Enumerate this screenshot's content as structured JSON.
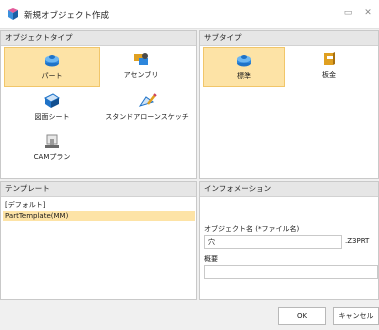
{
  "window": {
    "title": "新規オブジェクト作成"
  },
  "object_type": {
    "header": "オブジェクトタイプ",
    "items": [
      {
        "label": "パート",
        "icon": "part-icon",
        "selected": true
      },
      {
        "label": "アセンブリ",
        "icon": "assembly-icon",
        "selected": false
      },
      {
        "label": "図面シート",
        "icon": "drawing-sheet-icon",
        "selected": false
      },
      {
        "label": "スタンドアローンスケッチ",
        "icon": "standalone-sketch-icon",
        "selected": false
      },
      {
        "label": "CAMプラン",
        "icon": "cam-plan-icon",
        "selected": false
      }
    ]
  },
  "sub_type": {
    "header": "サブタイプ",
    "items": [
      {
        "label": "標準",
        "icon": "standard-part-icon",
        "selected": true
      },
      {
        "label": "板金",
        "icon": "sheet-metal-icon",
        "selected": false
      }
    ]
  },
  "template": {
    "header": "テンプレート",
    "items": [
      {
        "label": "[デフォルト]",
        "selected": false
      },
      {
        "label": "PartTemplate(MM)",
        "selected": true
      }
    ]
  },
  "information": {
    "header": "インフォメーション",
    "object_name_label": "オブジェクト名 (*ファイル名)",
    "object_name_value": "穴",
    "extension": ".Z3PRT",
    "description_label": "概要",
    "description_value": ""
  },
  "buttons": {
    "ok": "OK",
    "cancel": "キャンセル"
  },
  "colors": {
    "selection_fill": "#fde3a6",
    "selection_border": "#f1c66a",
    "accent_blue": "#1f73c8"
  }
}
